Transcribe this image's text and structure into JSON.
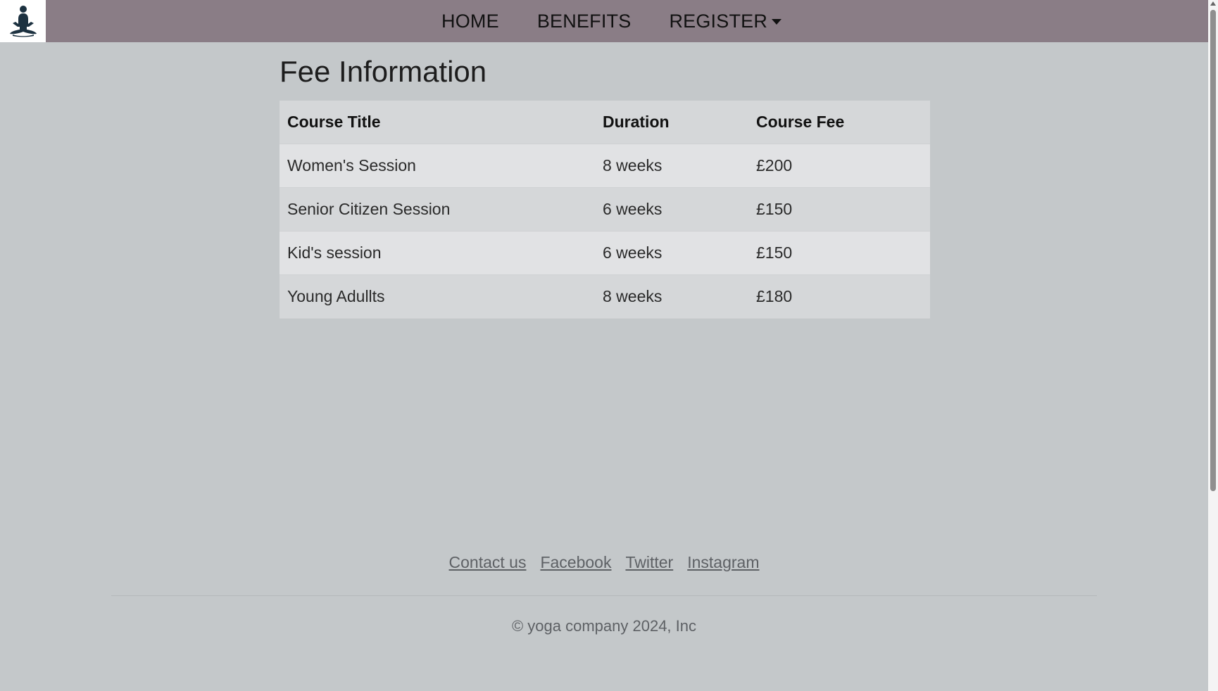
{
  "nav": {
    "logo_icon": "meditation-figure-icon",
    "items": [
      {
        "label": "HOME"
      },
      {
        "label": "BENEFITS"
      },
      {
        "label": "REGISTER",
        "has_dropdown": true
      }
    ]
  },
  "main": {
    "title": "Fee Information",
    "table": {
      "headers": [
        "Course Title",
        "Duration",
        "Course Fee"
      ],
      "rows": [
        [
          "Women's Session",
          "8 weeks",
          "£200"
        ],
        [
          "Senior Citizen Session",
          "6 weeks",
          "£150"
        ],
        [
          "Kid's session",
          "6 weeks",
          "£150"
        ],
        [
          "Young Adullts",
          "8 weeks",
          "£180"
        ]
      ]
    }
  },
  "footer": {
    "links": [
      "Contact us",
      "Facebook",
      "Twitter",
      "Instagram"
    ],
    "copyright": "© yoga company 2024, Inc"
  },
  "colors": {
    "navbar": "#8a7d86",
    "page_background": "#c4c8ca",
    "table_row_dark": "#d5d7d9",
    "table_row_light": "#e1e2e4",
    "footer_text": "#5e6165"
  }
}
